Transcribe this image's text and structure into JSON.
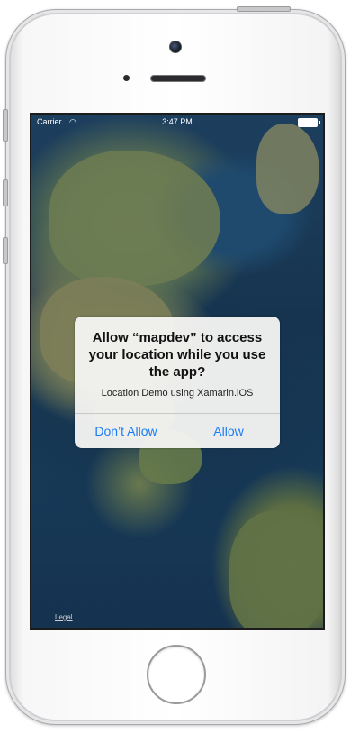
{
  "status_bar": {
    "carrier": "Carrier",
    "time": "3:47 PM",
    "wifi_icon": "wifi-icon",
    "battery_icon": "battery-icon"
  },
  "map": {
    "legal_label": "Legal"
  },
  "alert": {
    "title": "Allow “mapdev” to access your location while you use the app?",
    "message": "Location Demo using Xamarin.iOS",
    "dont_allow_label": "Don’t Allow",
    "allow_label": "Allow",
    "button_color": "#1a7cf5"
  },
  "device": {
    "home_button_icon": "home-button"
  }
}
